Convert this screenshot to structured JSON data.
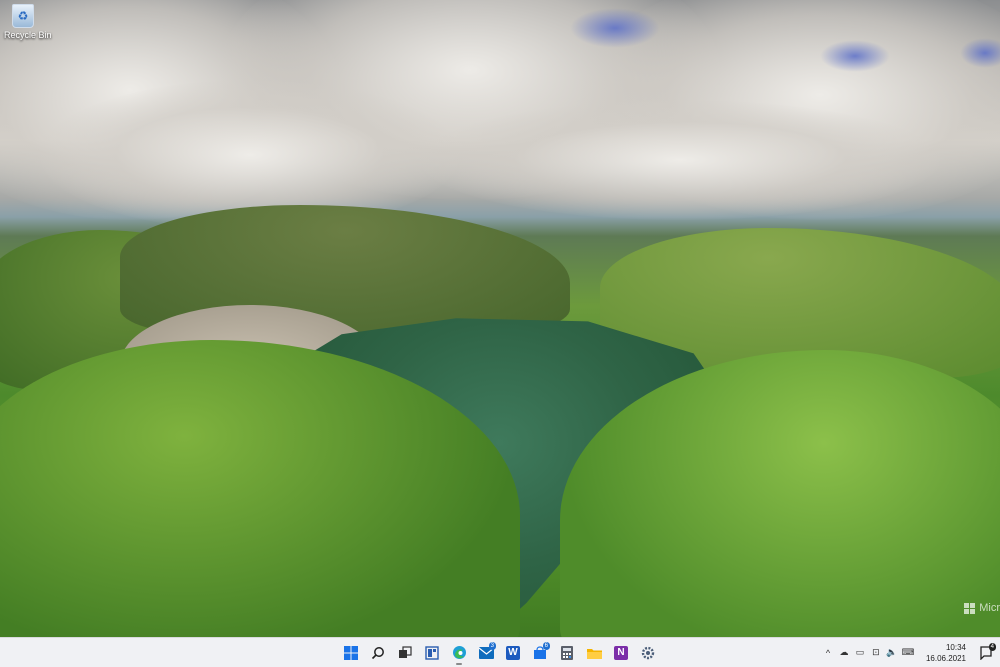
{
  "desktop": {
    "icons": [
      {
        "label": "Recycle Bin",
        "icon": "recycle-bin-icon"
      }
    ],
    "watermark": "Micr"
  },
  "taskbar": {
    "apps": [
      {
        "name": "start",
        "icon": "windows-start-icon"
      },
      {
        "name": "search",
        "icon": "search-icon"
      },
      {
        "name": "task-view",
        "icon": "task-view-icon"
      },
      {
        "name": "widgets",
        "icon": "widgets-icon"
      },
      {
        "name": "edge",
        "icon": "edge-icon"
      },
      {
        "name": "mail",
        "icon": "mail-icon",
        "badge": "3"
      },
      {
        "name": "word",
        "icon": "word-icon",
        "label": "W"
      },
      {
        "name": "store",
        "icon": "store-icon",
        "badge": "6"
      },
      {
        "name": "calculator",
        "icon": "calculator-icon"
      },
      {
        "name": "file-explorer",
        "icon": "folder-icon"
      },
      {
        "name": "onenote",
        "icon": "onenote-icon",
        "label": "N"
      },
      {
        "name": "settings",
        "icon": "gear-icon"
      }
    ],
    "tray": {
      "icons": [
        "chevron-up-icon",
        "cloud-icon",
        "battery-icon",
        "network-icon",
        "volume-icon",
        "keyboard-icon"
      ],
      "time": "10:34",
      "date": "16.06.2021"
    },
    "notifications": {
      "icon": "notification-icon",
      "count": "4"
    }
  },
  "colors": {
    "accent": "#1f6fd0",
    "taskbar": "#f0f1f4"
  }
}
